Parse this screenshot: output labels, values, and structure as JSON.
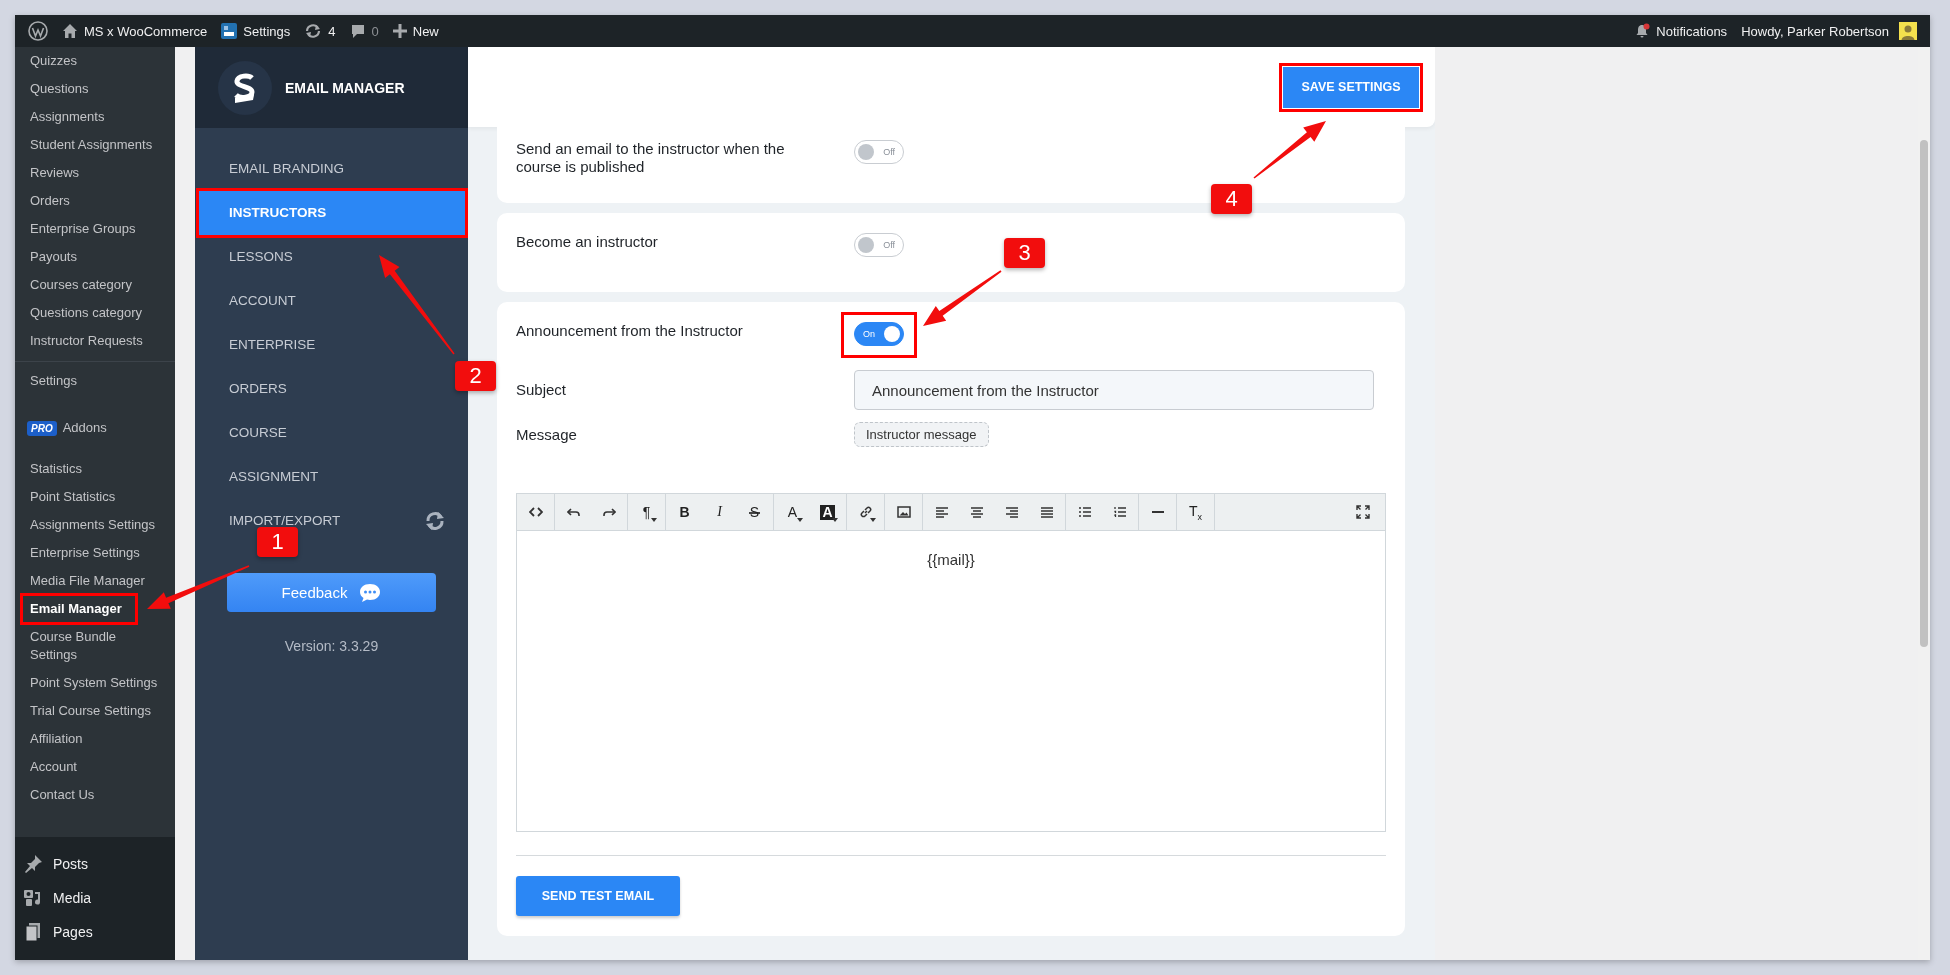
{
  "admin_bar": {
    "site": "MS x WooCommerce",
    "settings": "Settings",
    "updates": "4",
    "comments": "0",
    "new": "New",
    "notifications": "Notifications",
    "greeting": "Howdy, Parker Robertson"
  },
  "admin_menu": {
    "groups": [
      [
        {
          "label": "Quizzes",
          "selected": false,
          "highlighted": false
        },
        {
          "label": "Questions",
          "selected": false,
          "highlighted": false
        },
        {
          "label": "Assignments",
          "selected": false,
          "highlighted": false
        },
        {
          "label": "Student Assignments",
          "selected": false,
          "highlighted": false
        },
        {
          "label": "Reviews",
          "selected": false,
          "highlighted": false
        },
        {
          "label": "Orders",
          "selected": false,
          "highlighted": false
        },
        {
          "label": "Enterprise Groups",
          "selected": false,
          "highlighted": false
        },
        {
          "label": "Payouts",
          "selected": false,
          "highlighted": false
        },
        {
          "label": "Courses category",
          "selected": false,
          "highlighted": false
        },
        {
          "label": "Questions category",
          "selected": false,
          "highlighted": false
        },
        {
          "label": "Instructor Requests",
          "selected": false,
          "highlighted": false
        }
      ],
      [
        {
          "label": "Settings",
          "selected": false,
          "highlighted": false
        }
      ],
      [
        {
          "label": "Addons",
          "badge": "PRO",
          "selected": false,
          "highlighted": false
        }
      ],
      [
        {
          "label": "Statistics",
          "selected": false,
          "highlighted": false
        },
        {
          "label": "Point Statistics",
          "selected": false,
          "highlighted": false
        },
        {
          "label": "Assignments Settings",
          "selected": false,
          "highlighted": false
        },
        {
          "label": "Enterprise Settings",
          "selected": false,
          "highlighted": false
        },
        {
          "label": "Media File Manager",
          "selected": false,
          "highlighted": false
        },
        {
          "label": "Email Manager",
          "selected": true,
          "highlighted": true
        },
        {
          "label": "Course Bundle Settings",
          "selected": false,
          "highlighted": false
        },
        {
          "label": "Point System Settings",
          "selected": false,
          "highlighted": false
        },
        {
          "label": "Trial Course Settings",
          "selected": false,
          "highlighted": false
        },
        {
          "label": "Affiliation",
          "selected": false,
          "highlighted": false
        },
        {
          "label": "Account",
          "selected": false,
          "highlighted": false
        },
        {
          "label": "Contact Us",
          "selected": false,
          "highlighted": false
        }
      ]
    ],
    "main_items": [
      {
        "label": "Posts",
        "kind": "pin"
      },
      {
        "label": "Media",
        "kind": "media"
      },
      {
        "label": "Pages",
        "kind": "pages"
      }
    ]
  },
  "email_manager": {
    "title": "EMAIL MANAGER",
    "nav": [
      {
        "label": "EMAIL BRANDING",
        "kind": "link",
        "selected": false,
        "highlighted": false
      },
      {
        "label": "INSTRUCTORS",
        "kind": "link",
        "selected": true,
        "highlighted": true
      },
      {
        "label": "LESSONS",
        "kind": "link",
        "selected": false,
        "highlighted": false
      },
      {
        "label": "ACCOUNT",
        "kind": "link",
        "selected": false,
        "highlighted": false
      },
      {
        "label": "ENTERPRISE",
        "kind": "link",
        "selected": false,
        "highlighted": false
      },
      {
        "label": "ORDERS",
        "kind": "link",
        "selected": false,
        "highlighted": false
      },
      {
        "label": "COURSE",
        "kind": "link",
        "selected": false,
        "highlighted": false
      },
      {
        "label": "ASSIGNMENT",
        "kind": "link",
        "selected": false,
        "highlighted": false
      },
      {
        "label": "IMPORT/EXPORT",
        "kind": "sync",
        "selected": false,
        "highlighted": false
      }
    ],
    "feedback": "Feedback",
    "version": "Version: 3.3.29"
  },
  "save_button": {
    "label": "SAVE SETTINGS",
    "highlighted": true
  },
  "settings": [
    {
      "label": "Send an email to the instructor when the course is published",
      "on": false,
      "toggle_label": "Off",
      "highlighted": false
    },
    {
      "label": "Become an instructor",
      "on": false,
      "toggle_label": "Off",
      "highlighted": false
    },
    {
      "label": "Announcement from the Instructor",
      "on": true,
      "toggle_label": "On",
      "highlighted": true,
      "subject_label": "Subject",
      "subject": "Announcement from the Instructor",
      "message_label": "Message",
      "tag": "Instructor message",
      "editor": {
        "toolbar": [
          [
            {
              "kind": "code"
            }
          ],
          [
            {
              "kind": "undo"
            },
            {
              "kind": "redo"
            }
          ],
          [
            {
              "kind": "glyph",
              "glyph": "¶",
              "dropdown": true
            }
          ],
          [
            {
              "kind": "bold",
              "glyph": "B"
            },
            {
              "kind": "italic",
              "glyph": "I"
            },
            {
              "kind": "strike",
              "glyph": "S"
            }
          ],
          [
            {
              "kind": "glyph",
              "glyph": "A",
              "dropdown": true
            },
            {
              "kind": "inverse",
              "glyph": "A",
              "dropdown": true
            }
          ],
          [
            {
              "kind": "link",
              "dropdown": true
            }
          ],
          [
            {
              "kind": "image"
            }
          ],
          [
            {
              "kind": "align-left"
            },
            {
              "kind": "align-center"
            },
            {
              "kind": "align-right"
            },
            {
              "kind": "align-justify"
            }
          ],
          [
            {
              "kind": "bullet-list"
            },
            {
              "kind": "numbered-list"
            }
          ],
          [
            {
              "kind": "rule"
            }
          ],
          [
            {
              "kind": "glyph",
              "glyph": "T$_{x}$"
            }
          ],
          [
            {
              "kind": "fullscreen"
            }
          ]
        ],
        "content": "{{mail}}"
      },
      "test_button": "SEND TEST EMAIL"
    }
  ],
  "annotations": [
    {
      "label": "1"
    },
    {
      "label": "2"
    },
    {
      "label": "3"
    },
    {
      "label": "4"
    }
  ]
}
